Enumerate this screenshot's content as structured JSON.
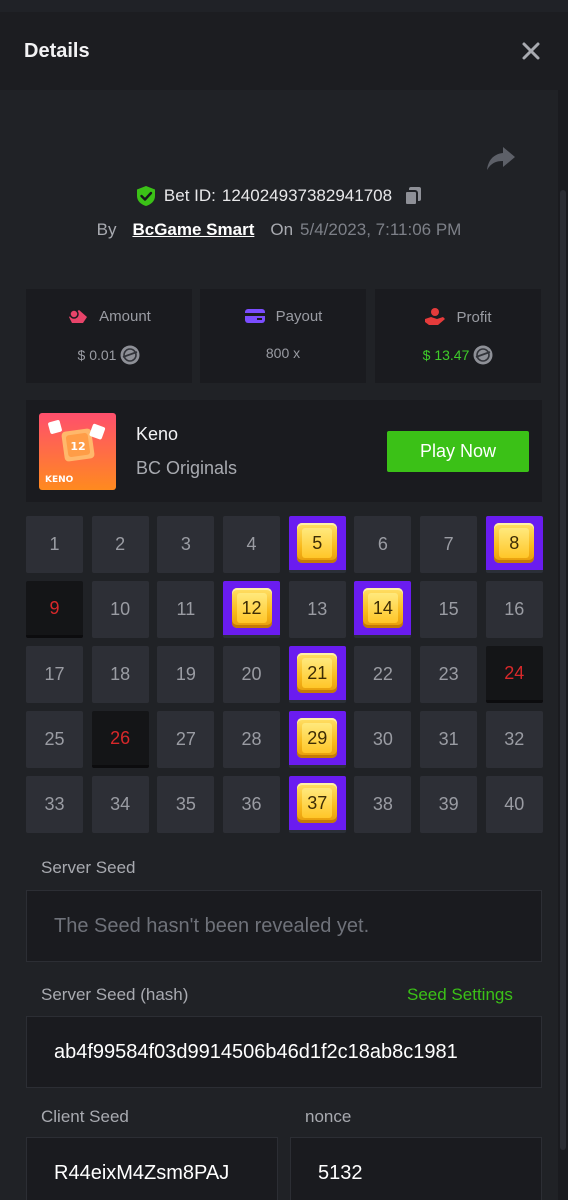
{
  "header": {
    "title": "Details"
  },
  "bet": {
    "id_label": "Bet ID:",
    "id": "124024937382941708",
    "by_label": "By",
    "user": "BcGame Smart",
    "on_label": "On",
    "date": "5/4/2023, 7:11:06 PM"
  },
  "stats": {
    "amount": {
      "label": "Amount",
      "value": "$ 0.01"
    },
    "payout": {
      "label": "Payout",
      "value": "800 x"
    },
    "profit": {
      "label": "Profit",
      "value": "$ 13.47"
    }
  },
  "game": {
    "name": "Keno",
    "provider": "BC Originals",
    "thumb_label": "KENO",
    "thumb_number": "12",
    "play_label": "Play Now"
  },
  "keno": {
    "numbers": [
      "1",
      "2",
      "3",
      "4",
      "5",
      "6",
      "7",
      "8",
      "9",
      "10",
      "11",
      "12",
      "13",
      "14",
      "15",
      "16",
      "17",
      "18",
      "19",
      "20",
      "21",
      "22",
      "23",
      "24",
      "25",
      "26",
      "27",
      "28",
      "29",
      "30",
      "31",
      "32",
      "33",
      "34",
      "35",
      "36",
      "37",
      "38",
      "39",
      "40"
    ],
    "hits": [
      5,
      8,
      12,
      14,
      21,
      29,
      37
    ],
    "misses": [
      9,
      24,
      26
    ]
  },
  "seeds": {
    "server_seed_label": "Server Seed",
    "server_seed_value": "The Seed hasn't been revealed yet.",
    "hash_label": "Server Seed (hash)",
    "settings_link": "Seed Settings",
    "hash_value": "ab4f99584f03d9914506b46d1f2c18ab8c1981",
    "client_seed_label": "Client Seed",
    "client_seed_value": "R44eixM4Zsm8PAJ",
    "nonce_label": "nonce",
    "nonce_value": "5132"
  },
  "colors": {
    "accent_green": "#3bc117",
    "hit_purple": "#6a1cf0",
    "miss_red": "#d8282a",
    "gem_gold": "#ffc628"
  },
  "icons": [
    "close-icon",
    "share-icon",
    "shield-check-icon",
    "copy-icon",
    "amount-icon",
    "payout-icon",
    "profit-icon",
    "coin-icon"
  ]
}
